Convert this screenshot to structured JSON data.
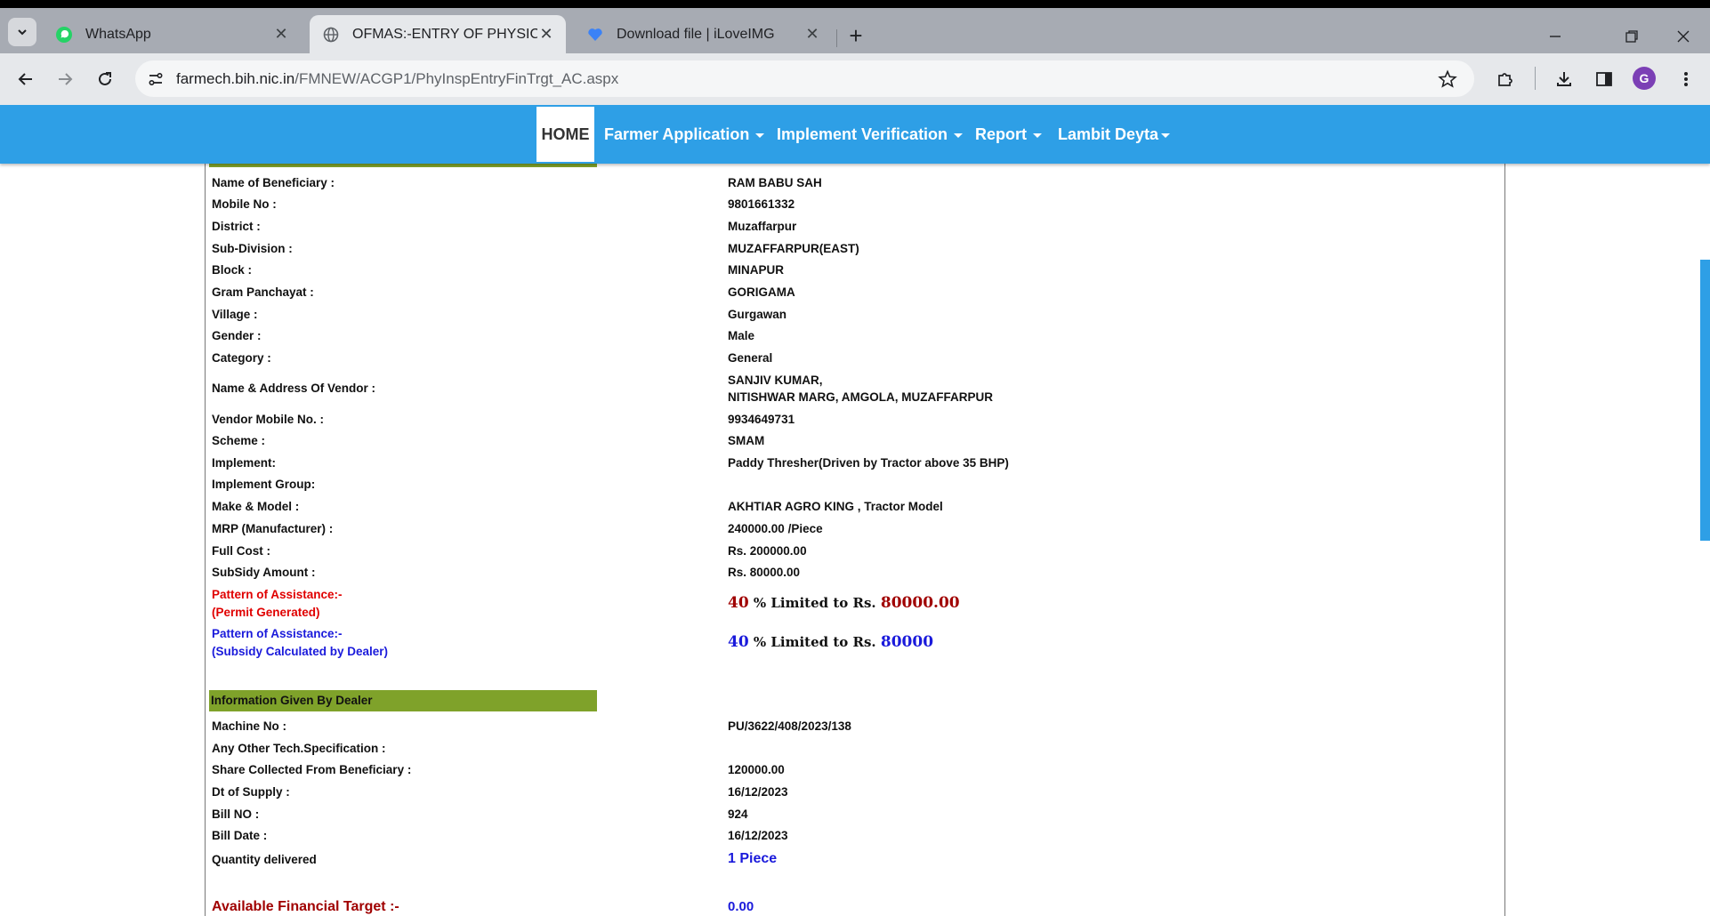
{
  "browser": {
    "tabs": [
      {
        "title": "WhatsApp",
        "icon": "whatsapp-icon",
        "active": false
      },
      {
        "title": "OFMAS:-ENTRY OF PHYSICAL INSPECTION",
        "icon": "globe-icon",
        "active": true
      },
      {
        "title": "Download file | iLoveIMG",
        "icon": "iloveimg-icon",
        "active": false
      }
    ],
    "url_host": "farmech.bih.nic.in",
    "url_path": "/FMNEW/ACGP1/PhyInspEntryFinTrgt_AC.aspx",
    "profile_initial": "G"
  },
  "nav": {
    "home": "HOME",
    "items": [
      "Farmer Application",
      "Implement Verification",
      "Report",
      "Lambit Deyta"
    ]
  },
  "details": [
    {
      "label": "Name of Beneficiary :",
      "value": "RAM BABU SAH"
    },
    {
      "label": "Mobile No :",
      "value": "9801661332"
    },
    {
      "label": "District :",
      "value": "Muzaffarpur"
    },
    {
      "label": "Sub-Division :",
      "value": "MUZAFFARPUR(EAST)"
    },
    {
      "label": "Block :",
      "value": "MINAPUR"
    },
    {
      "label": "Gram Panchayat :",
      "value": "GORIGAMA"
    },
    {
      "label": "Village :",
      "value": "Gurgawan"
    },
    {
      "label": "Gender :",
      "value": "Male"
    },
    {
      "label": "Category :",
      "value": "General"
    },
    {
      "label": "Name & Address Of Vendor :",
      "value": "SANJIV KUMAR,",
      "value2": "NITISHWAR MARG, AMGOLA, MUZAFFARPUR"
    },
    {
      "label": "Vendor Mobile No. :",
      "value": "9934649731"
    },
    {
      "label": "Scheme :",
      "value": "SMAM"
    },
    {
      "label": "Implement:",
      "value": "Paddy Thresher(Driven by Tractor above 35 BHP)"
    },
    {
      "label": "Implement Group:",
      "value": ""
    },
    {
      "label": "Make & Model :",
      "value": "AKHTIAR AGRO KING , Tractor Model"
    },
    {
      "label": "MRP (Manufacturer) :",
      "value": "240000.00 /Piece"
    },
    {
      "label": "Full Cost :",
      "value": "Rs. 200000.00"
    },
    {
      "label": "SubSidy Amount :",
      "value": "Rs. 80000.00"
    }
  ],
  "pattern_permit": {
    "label1": "Pattern of Assistance:-",
    "label2": "(Permit Generated)",
    "percent": "40",
    "text": " % Limited to Rs. ",
    "amount": "80000.00"
  },
  "pattern_dealer": {
    "label1": "Pattern of Assistance:-",
    "label2": "(Subsidy Calculated by Dealer)",
    "percent": "40",
    "text": " % Limited to Rs. ",
    "amount": "80000"
  },
  "dealer_section": {
    "title": "Information Given By Dealer",
    "rows": [
      {
        "label": "Machine No :",
        "value": "PU/3622/408/2023/138"
      },
      {
        "label": "Any Other Tech.Specification :",
        "value": ""
      },
      {
        "label": "Share Collected From Beneficiary :",
        "value": "120000.00"
      },
      {
        "label": "Dt of Supply :",
        "value": "16/12/2023"
      },
      {
        "label": "Bill NO :",
        "value": "924"
      },
      {
        "label": "Bill Date :",
        "value": "16/12/2023"
      }
    ],
    "quantity_label": "Quantity delivered",
    "quantity_value": "1 Piece"
  },
  "target": {
    "label": "Available Financial Target :-",
    "value": "0.00"
  }
}
